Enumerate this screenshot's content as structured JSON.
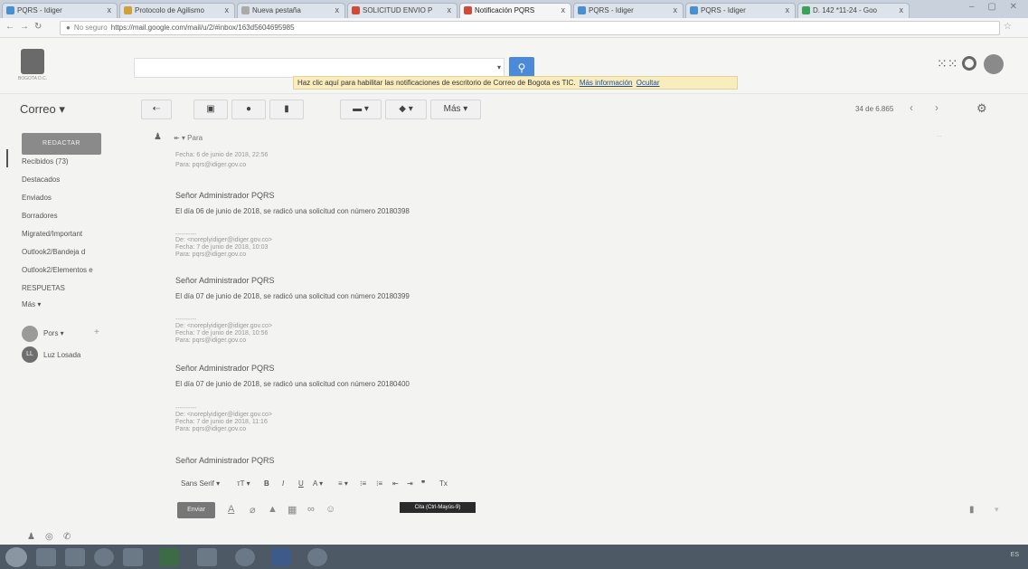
{
  "tabs": [
    {
      "label": "PQRS - Idiger",
      "tx": "x"
    },
    {
      "label": "Protocolo de Agilismo",
      "tx": "x"
    },
    {
      "label": "Nueva pestaña",
      "tx": "x"
    },
    {
      "label": "SOLICITUD ENVIO P",
      "tx": "x"
    },
    {
      "label": "Notificación PQRS",
      "tx": "x"
    },
    {
      "label": "PQRS - Idiger",
      "tx": "x"
    },
    {
      "label": "PQRS - Idiger",
      "tx": "x"
    },
    {
      "label": "D. 142 *11-24 - Goo",
      "tx": "x"
    }
  ],
  "address": {
    "security": "No seguro",
    "url": "https://mail.google.com/mail/u/2/#inbox/163d5604695985"
  },
  "header": {
    "logo_caption": "BOGOTA D.C.",
    "search_drop": "▾",
    "notif_text": "Haz clic aquí para habilitar las notificaciones de escritorio de Correo de Bogota es TIC.",
    "notif_more": "Más información",
    "notif_hide": "Ocultar"
  },
  "toolbar": {
    "app_label": "Correo ▾",
    "more_label": "Más ▾",
    "pager": "34 de 6.865"
  },
  "sidebar": {
    "compose": "REDACTAR",
    "items": [
      "Recibidos (73)",
      "Destacados",
      "Enviados",
      "Borradores",
      "Migrated/Important",
      "Outlook2/Bandeja d",
      "Outlook2/Elementos e",
      "RESPUETAS",
      "Más ▾"
    ],
    "hangout_pors": "Pors ▾",
    "hangout_plus": "+",
    "hangout_luz_initials": "LL",
    "hangout_luz": "Luz Losada"
  },
  "message": {
    "reply_label": "Para",
    "right_meta": "...",
    "lines": [
      {
        "kind": "meta",
        "text": "Fecha: 6 de junio de 2018, 22:56"
      },
      {
        "kind": "meta",
        "text": "Para: pqrs@idiger.gov.co"
      },
      {
        "kind": "head",
        "text": "Señor Administrador PQRS"
      },
      {
        "kind": "body",
        "text": "El día 06 de junio de 2018, se radicó una solicitud con número 20180398"
      },
      {
        "kind": "dash",
        "text": "----------"
      },
      {
        "kind": "meta",
        "text": "De: <noreplyidiger@idiger.gov.co>"
      },
      {
        "kind": "meta",
        "text": "Fecha: 7 de junio de 2018, 10:03"
      },
      {
        "kind": "meta",
        "text": "Para: pqrs@idiger.gov.co"
      },
      {
        "kind": "head",
        "text": "Señor Administrador PQRS"
      },
      {
        "kind": "body",
        "text": "El día 07 de junio de 2018, se radicó una solicitud con número 20180399"
      },
      {
        "kind": "dash",
        "text": "----------"
      },
      {
        "kind": "meta",
        "text": "De: <noreplyidiger@idiger.gov.co>"
      },
      {
        "kind": "meta",
        "text": "Fecha: 7 de junio de 2018, 10:56"
      },
      {
        "kind": "meta",
        "text": "Para: pqrs@idiger.gov.co"
      },
      {
        "kind": "head",
        "text": "Señor Administrador PQRS"
      },
      {
        "kind": "body",
        "text": "El día 07 de junio de 2018, se radicó una solicitud con número 20180400"
      },
      {
        "kind": "dash",
        "text": "----------"
      },
      {
        "kind": "meta",
        "text": "De: <noreplyidiger@idiger.gov.co>"
      },
      {
        "kind": "meta",
        "text": "Fecha: 7 de junio de 2018, 11:16"
      },
      {
        "kind": "meta",
        "text": "Para: pqrs@idiger.gov.co"
      },
      {
        "kind": "head",
        "text": "Señor Administrador PQRS"
      }
    ]
  },
  "format": {
    "font": "Sans Serif ▾",
    "size": "тT ▾",
    "bold": "B",
    "italic": "I",
    "underline": "U",
    "color": "A ▾",
    "align": "≡ ▾",
    "olist": "⁝≡",
    "ulist": "⁝≡",
    "indent_less": "⇤",
    "indent_more": "⇥",
    "quote": "❞",
    "clear": "Tx",
    "tooltip": "Cita (Ctrl-Mayús-9)"
  },
  "compose": {
    "send": "Enviar"
  },
  "taskbar": {
    "tray": "ES"
  }
}
